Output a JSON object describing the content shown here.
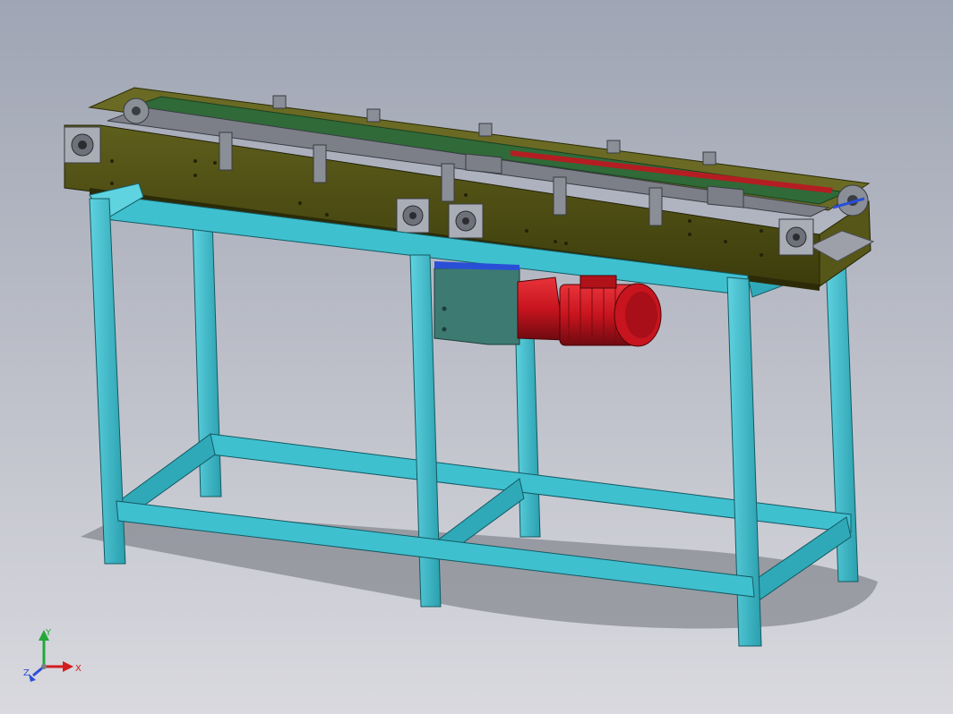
{
  "viewport": {
    "background_top": "#9fa5b4",
    "background_bottom": "#d9d9df"
  },
  "colors": {
    "frame": "#3fc0cf",
    "frame_dark": "#1f8f9c",
    "frame_shadow": "#2a7f8a",
    "conveyor_body": "#4f4f14",
    "conveyor_top": "#6a6a24",
    "conveyor_inner": "#2f6a38",
    "chain": "#7c7f88",
    "motor": "#c8141e",
    "motor_dark": "#7a0a10",
    "gearbox_cover": "#3d7a72",
    "bearing": "#a9adb6",
    "axis_x": "#d21e1e",
    "axis_y": "#22a83a",
    "axis_z": "#2a4fd6"
  },
  "triad": {
    "x_label": "X",
    "y_label": "Y",
    "z_label": "Z"
  }
}
